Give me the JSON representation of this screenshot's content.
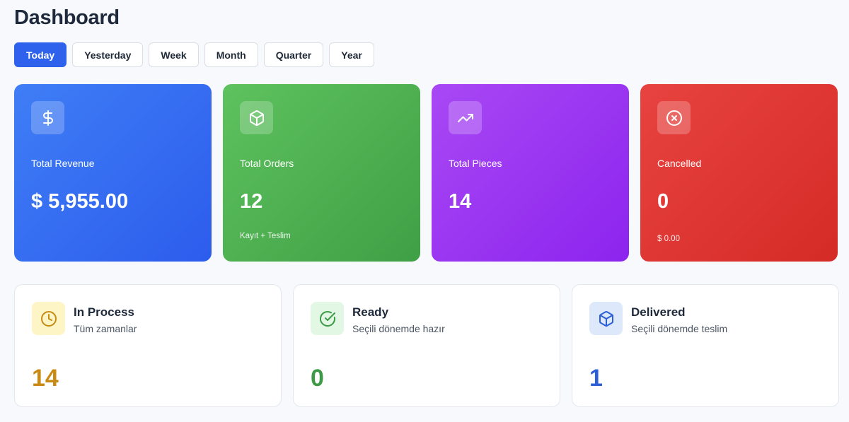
{
  "header": {
    "title": "Dashboard"
  },
  "filters": {
    "items": [
      {
        "label": "Today",
        "active": true
      },
      {
        "label": "Yesterday"
      },
      {
        "label": "Week"
      },
      {
        "label": "Month"
      },
      {
        "label": "Quarter"
      },
      {
        "label": "Year"
      }
    ]
  },
  "stats": [
    {
      "label": "Total Revenue",
      "value": "$ 5,955.00",
      "sub": "",
      "icon": "dollar-icon",
      "color": "#3a73f3"
    },
    {
      "label": "Total Orders",
      "value": "12",
      "sub": "Kayıt + Teslim",
      "icon": "box-icon",
      "color": "#4fb052"
    },
    {
      "label": "Total Pieces",
      "value": "14",
      "sub": "",
      "icon": "trending-up-icon",
      "color": "#9b35f2"
    },
    {
      "label": "Cancelled",
      "value": "0",
      "sub": "$ 0.00",
      "icon": "x-circle-icon",
      "color": "#e03a36"
    }
  ],
  "status": [
    {
      "title": "In Process",
      "sub": "Tüm zamanlar",
      "value": "14",
      "icon": "clock-icon",
      "color": "#c88a12",
      "icon_bg": "#fef5c7"
    },
    {
      "title": "Ready",
      "sub": "Seçili dönemde hazır",
      "value": "0",
      "icon": "check-circle-icon",
      "color": "#3d9a46",
      "icon_bg": "#e2f7e4"
    },
    {
      "title": "Delivered",
      "sub": "Seçili dönemde teslim",
      "value": "1",
      "icon": "box-icon",
      "color": "#2c5fd6",
      "icon_bg": "#dde9fb"
    }
  ]
}
